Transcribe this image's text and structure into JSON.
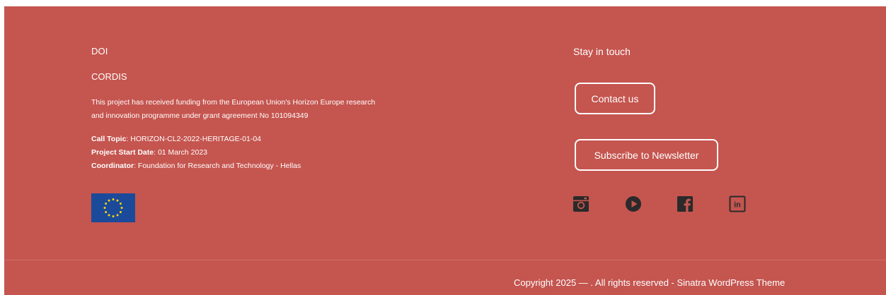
{
  "footer": {
    "links": {
      "doi": "DOI",
      "cordis": "CORDIS"
    },
    "funding_text": "This project has received funding from the European Union's Horizon Europe research and innovation programme under grant agreement No 101094349",
    "call_topic": {
      "label": "Call Topic",
      "value": ": HORIZON-CL2-2022-HERITAGE-01-04"
    },
    "start_date": {
      "label": "Project Start Date",
      "value": ": 01 March 2023"
    },
    "coordinator": {
      "label": "Coordinator",
      "value": ": Foundation for Research and Technology - Hellas"
    },
    "stay_in_touch": "Stay in touch",
    "buttons": {
      "contact": "Contact us",
      "newsletter": "Subscribe to Newsletter"
    },
    "social_icons": [
      "instagram-icon",
      "youtube-icon",
      "facebook-icon",
      "linkedin-icon"
    ],
    "copyright_text": "Copyright 2025 — . All rights reserved - ",
    "copyright_link": "Sinatra WordPress Theme"
  },
  "colors": {
    "footer_bg": "#c5554f",
    "text": "#ffffff",
    "icon": "#2a2a2a",
    "eu_blue": "#1c4a9a",
    "eu_star": "#f6d40f"
  }
}
